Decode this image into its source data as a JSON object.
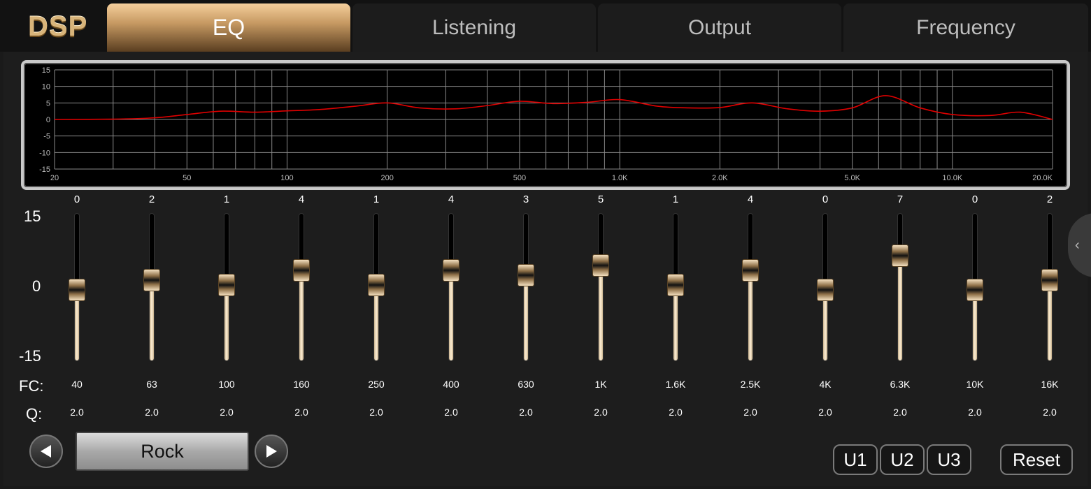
{
  "logo": "DSP",
  "tabs": [
    {
      "label": "EQ",
      "active": true
    },
    {
      "label": "Listening",
      "active": false
    },
    {
      "label": "Output",
      "active": false
    },
    {
      "label": "Frequency",
      "active": false
    }
  ],
  "chart_data": {
    "type": "line",
    "x_scale": "log",
    "xlim": [
      20,
      20000
    ],
    "ylim": [
      -15,
      15
    ],
    "y_ticks": [
      "15",
      "10",
      "5",
      "0",
      "-5",
      "-10",
      "-15"
    ],
    "y_tick_values": [
      15,
      10,
      5,
      0,
      -5,
      -10,
      -15
    ],
    "x_tick_labels": [
      "20",
      "50",
      "100",
      "200",
      "500",
      "1.0K",
      "2.0K",
      "5.0K",
      "10.0K",
      "20.0K"
    ],
    "x_tick_values": [
      20,
      50,
      100,
      200,
      500,
      1000,
      2000,
      5000,
      10000,
      20000
    ],
    "x_grid": [
      20,
      30,
      40,
      50,
      60,
      70,
      80,
      90,
      100,
      200,
      300,
      400,
      500,
      600,
      700,
      800,
      900,
      1000,
      2000,
      3000,
      4000,
      5000,
      6000,
      7000,
      8000,
      9000,
      10000,
      20000
    ],
    "grid": true,
    "line_color": "#e00000",
    "series": [
      {
        "x": [
          20,
          30,
          40,
          50,
          63,
          80,
          100,
          125,
          160,
          200,
          250,
          320,
          400,
          500,
          630,
          800,
          1000,
          1300,
          1600,
          2000,
          2500,
          3200,
          4000,
          5000,
          6300,
          8000,
          10000,
          13000,
          16000,
          20000
        ],
        "values": [
          0,
          0.1,
          0.5,
          1.5,
          2.5,
          2.2,
          2.6,
          3.0,
          4.0,
          5.0,
          3.5,
          3.2,
          4.2,
          5.5,
          4.8,
          5.2,
          6.0,
          4.0,
          3.5,
          3.6,
          5.0,
          3.2,
          2.5,
          3.5,
          7.2,
          3.5,
          1.5,
          1.2,
          2.2,
          0
        ]
      }
    ]
  },
  "eq": {
    "range_top": "15",
    "range_mid": "0",
    "range_bottom": "-15",
    "gain_min": -15,
    "gain_max": 15,
    "fc_label": "FC:",
    "q_label": "Q:",
    "bands": [
      {
        "gain": "0",
        "fc": "40",
        "q": "2.0"
      },
      {
        "gain": "2",
        "fc": "63",
        "q": "2.0"
      },
      {
        "gain": "1",
        "fc": "100",
        "q": "2.0"
      },
      {
        "gain": "4",
        "fc": "160",
        "q": "2.0"
      },
      {
        "gain": "1",
        "fc": "250",
        "q": "2.0"
      },
      {
        "gain": "4",
        "fc": "400",
        "q": "2.0"
      },
      {
        "gain": "3",
        "fc": "630",
        "q": "2.0"
      },
      {
        "gain": "5",
        "fc": "1K",
        "q": "2.0"
      },
      {
        "gain": "1",
        "fc": "1.6K",
        "q": "2.0"
      },
      {
        "gain": "4",
        "fc": "2.5K",
        "q": "2.0"
      },
      {
        "gain": "0",
        "fc": "4K",
        "q": "2.0"
      },
      {
        "gain": "7",
        "fc": "6.3K",
        "q": "2.0"
      },
      {
        "gain": "0",
        "fc": "10K",
        "q": "2.0"
      },
      {
        "gain": "2",
        "fc": "16K",
        "q": "2.0"
      }
    ]
  },
  "preset": {
    "name": "Rock",
    "prev_icon": "triangle-left-icon",
    "next_icon": "triangle-right-icon"
  },
  "user_presets": [
    "U1",
    "U2",
    "U3"
  ],
  "reset_label": "Reset",
  "side_handle_icon": "chevron-left-icon",
  "colors": {
    "accent": "#d8b47a",
    "curve": "#e00000"
  }
}
